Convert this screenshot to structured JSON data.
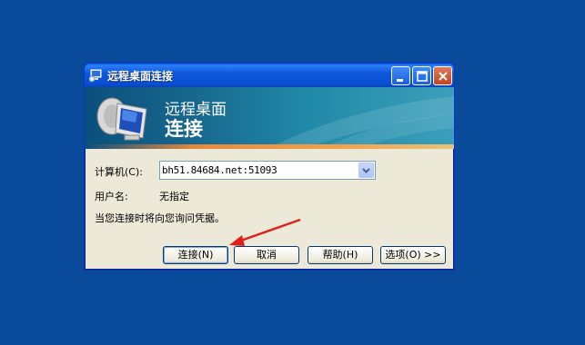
{
  "window": {
    "title": "远程桌面连接",
    "banner_line1": "远程桌面",
    "banner_line2": "连接"
  },
  "form": {
    "computer_label": "计算机(C):",
    "computer_value": "bh51.84684.net:51093",
    "username_label": "用户名:",
    "username_value": "无指定",
    "credentials_note": "当您连接时将向您询问凭据。"
  },
  "buttons": {
    "connect": "连接(N)",
    "cancel": "取消",
    "help": "帮助(H)",
    "options": "选项(O) >>"
  },
  "colors": {
    "desktop": "#0a4a9a",
    "titlebar": "#0a5fe8",
    "arrow": "#e0201a"
  }
}
